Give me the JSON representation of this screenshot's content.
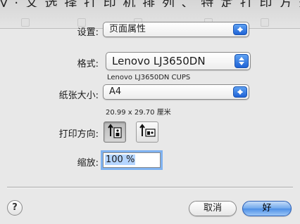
{
  "background_strip": {
    "text": "y · 文 选 择 打 印 机 排 列 、 特 定 打 印 方 式"
  },
  "settings": {
    "label": "设置:",
    "value": "页面属性"
  },
  "format": {
    "label": "格式:",
    "value": "Lenovo LJ3650DN",
    "subtitle": "Lenovo LJ3650DN CUPS"
  },
  "paper_size": {
    "label": "纸张大小:",
    "value": "A4",
    "dimensions": "20.99 x 29.70 厘米"
  },
  "orientation": {
    "label": "打印方向:",
    "options": [
      "portrait",
      "landscape"
    ],
    "selected": "portrait"
  },
  "scale": {
    "label": "缩放:",
    "value": "100 %"
  },
  "buttons": {
    "cancel": "取消",
    "ok": "好",
    "help": "?"
  },
  "colors": {
    "accent": "#1f63d6",
    "focus_ring": "#7fb2f0"
  }
}
